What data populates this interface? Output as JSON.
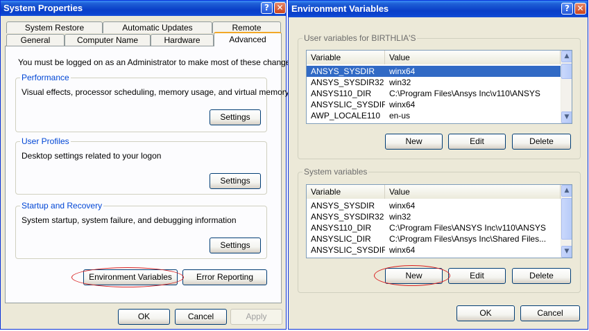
{
  "system_properties": {
    "title": "System Properties",
    "tabs_row1": [
      "System Restore",
      "Automatic Updates",
      "Remote"
    ],
    "tabs_row2": [
      "General",
      "Computer Name",
      "Hardware",
      "Advanced"
    ],
    "admin_notice": "You must be logged on as an Administrator to make most of these changes.",
    "performance": {
      "label": "Performance",
      "text": "Visual effects, processor scheduling, memory usage, and virtual memory",
      "button": "Settings"
    },
    "user_profiles": {
      "label": "User Profiles",
      "text": "Desktop settings related to your logon",
      "button": "Settings"
    },
    "startup_recovery": {
      "label": "Startup and Recovery",
      "text": "System startup, system failure, and debugging information",
      "button": "Settings"
    },
    "env_vars_button": "Environment Variables",
    "error_reporting_button": "Error Reporting",
    "ok": "OK",
    "cancel": "Cancel",
    "apply": "Apply"
  },
  "environment_variables": {
    "title": "Environment Variables",
    "user_group_label": "User variables for BIRTHLIA'S",
    "system_group_label": "System variables",
    "col_variable": "Variable",
    "col_value": "Value",
    "user_vars": [
      {
        "variable": "ANSYS_SYSDIR",
        "value": "winx64"
      },
      {
        "variable": "ANSYS_SYSDIR32",
        "value": "win32"
      },
      {
        "variable": "ANSYS110_DIR",
        "value": "C:\\Program Files\\Ansys Inc\\v110\\ANSYS"
      },
      {
        "variable": "ANSYSLIC_SYSDIR",
        "value": "winx64"
      },
      {
        "variable": "AWP_LOCALE110",
        "value": "en-us"
      }
    ],
    "system_vars": [
      {
        "variable": "ANSYS_SYSDIR",
        "value": "winx64"
      },
      {
        "variable": "ANSYS_SYSDIR32",
        "value": "win32"
      },
      {
        "variable": "ANSYS110_DIR",
        "value": "C:\\Program Files\\ANSYS Inc\\v110\\ANSYS"
      },
      {
        "variable": "ANSYSLIC_DIR",
        "value": "C:\\Program Files\\Ansys Inc\\Shared Files..."
      },
      {
        "variable": "ANSYSLIC_SYSDIR",
        "value": "winx64"
      }
    ],
    "new": "New",
    "edit": "Edit",
    "delete": "Delete",
    "ok": "OK",
    "cancel": "Cancel"
  },
  "colors": {
    "title_bar": "#0a3fc8",
    "selection": "#316ac5",
    "group_label": "#0046d5",
    "annotation": "#d81e1e"
  }
}
